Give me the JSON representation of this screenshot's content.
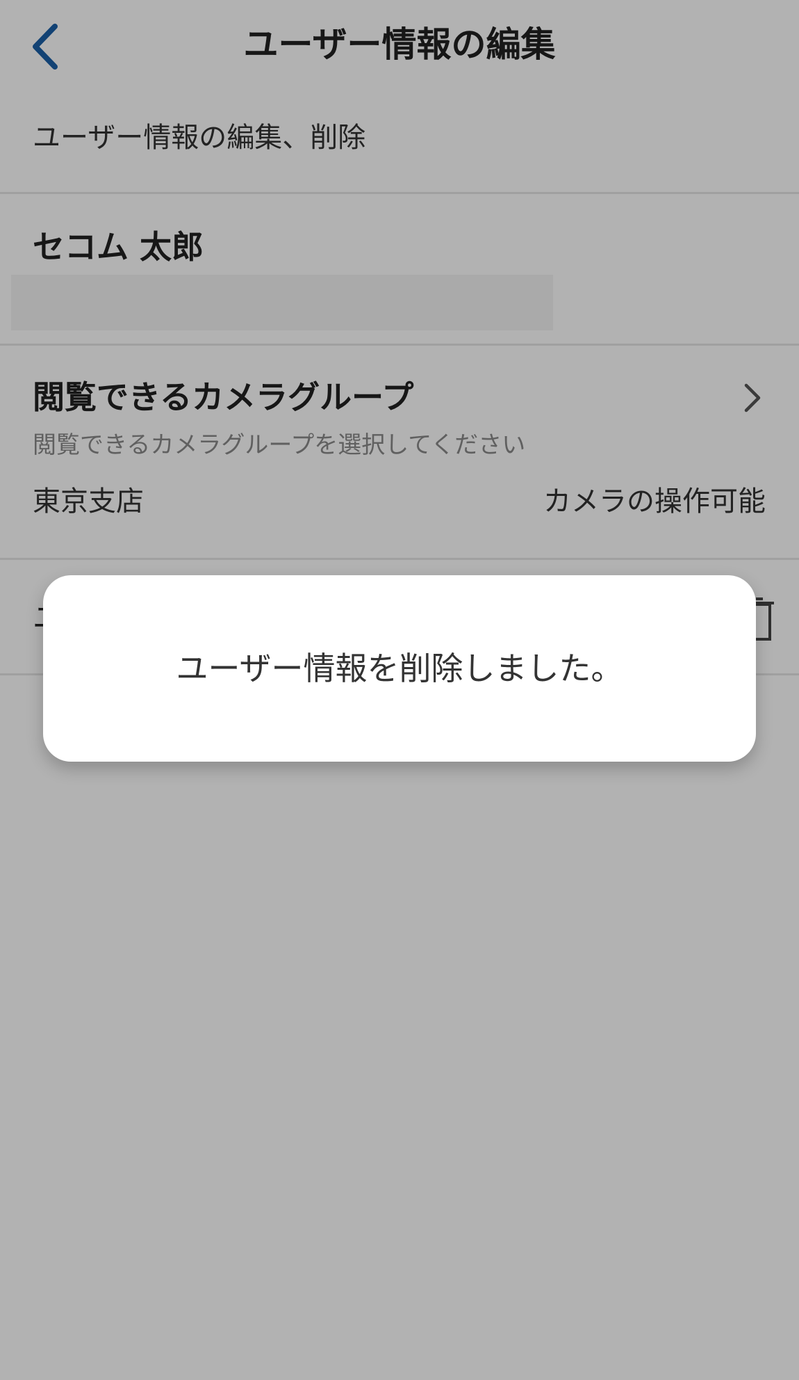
{
  "nav": {
    "title": "ユーザー情報の編集"
  },
  "section": {
    "header": "ユーザー情報の編集、削除"
  },
  "user": {
    "name": "セコム 太郎"
  },
  "camera_group": {
    "title": "閲覧できるカメラグループ",
    "hint": "閲覧できるカメラグループを選択してください",
    "group_name": "東京支店",
    "permission": "カメラの操作可能"
  },
  "delete_row": {
    "label": "ユ"
  },
  "toast": {
    "message": "ユーザー情報を削除しました。"
  },
  "colors": {
    "accent": "#1a5fa6",
    "overlay": "rgba(0,0,0,0.30)"
  },
  "icons": {
    "back": "chevron-left-icon",
    "chevron": "chevron-right-icon",
    "trash": "trash-icon"
  }
}
